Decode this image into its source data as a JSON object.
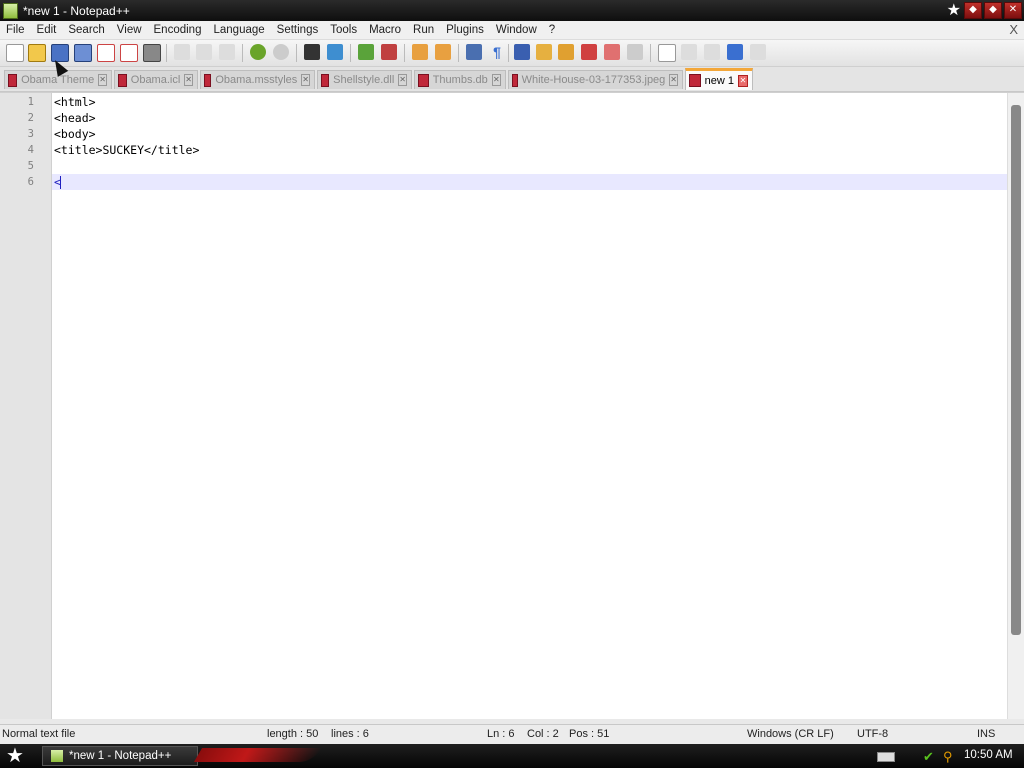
{
  "window": {
    "title": "*new 1 - Notepad++"
  },
  "menu": [
    "File",
    "Edit",
    "Search",
    "View",
    "Encoding",
    "Language",
    "Settings",
    "Tools",
    "Macro",
    "Run",
    "Plugins",
    "Window",
    "?"
  ],
  "menu_close_glyph": "X",
  "tabs": [
    {
      "label": "Obama Theme",
      "active": false
    },
    {
      "label": "Obama.icl",
      "active": false
    },
    {
      "label": "Obama.msstyles",
      "active": false
    },
    {
      "label": "Shellstyle.dll",
      "active": false
    },
    {
      "label": "Thumbs.db",
      "active": false
    },
    {
      "label": "White-House-03-177353.jpeg",
      "active": false
    },
    {
      "label": "new 1",
      "active": true
    }
  ],
  "editor": {
    "lines": [
      "<html>",
      "<head>",
      "<body>",
      "<title>SUCKEY</title>",
      "",
      "<"
    ],
    "line_numbers": [
      "1",
      "2",
      "3",
      "4",
      "5",
      "6"
    ]
  },
  "status": {
    "file_type": "Normal text file",
    "length": "length : 50",
    "lines": "lines : 6",
    "ln": "Ln : 6",
    "col": "Col : 2",
    "pos": "Pos : 51",
    "eol": "Windows (CR LF)",
    "encoding": "UTF-8",
    "mode": "INS"
  },
  "taskbar": {
    "task_label": "*new 1 - Notepad++",
    "clock": "10:50 AM"
  },
  "colors": {
    "active_tab_accent": "#f3a73a",
    "current_line": "#e8e8ff",
    "tab_icon": "#c0283a"
  }
}
